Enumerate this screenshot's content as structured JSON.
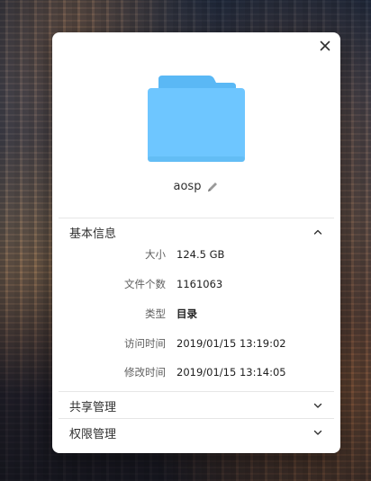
{
  "dialog": {
    "file_name": "aosp",
    "sections": {
      "basic": {
        "title": "基本信息",
        "rows": [
          {
            "label": "大小",
            "value": "124.5 GB"
          },
          {
            "label": "文件个数",
            "value": "1161063"
          },
          {
            "label": "类型",
            "value": "目录"
          },
          {
            "label": "访问时间",
            "value": "2019/01/15 13:19:02"
          },
          {
            "label": "修改时间",
            "value": "2019/01/15 13:14:05"
          }
        ]
      },
      "share": {
        "title": "共享管理"
      },
      "permissions": {
        "title": "权限管理"
      }
    }
  },
  "colors": {
    "folder_front": "#6ec6ff",
    "folder_back": "#5ab8f5",
    "dialog_bg": "#ffffff"
  },
  "icons": [
    "close-icon",
    "folder-icon",
    "edit-pencil-icon",
    "chevron-up-icon",
    "chevron-down-icon"
  ]
}
